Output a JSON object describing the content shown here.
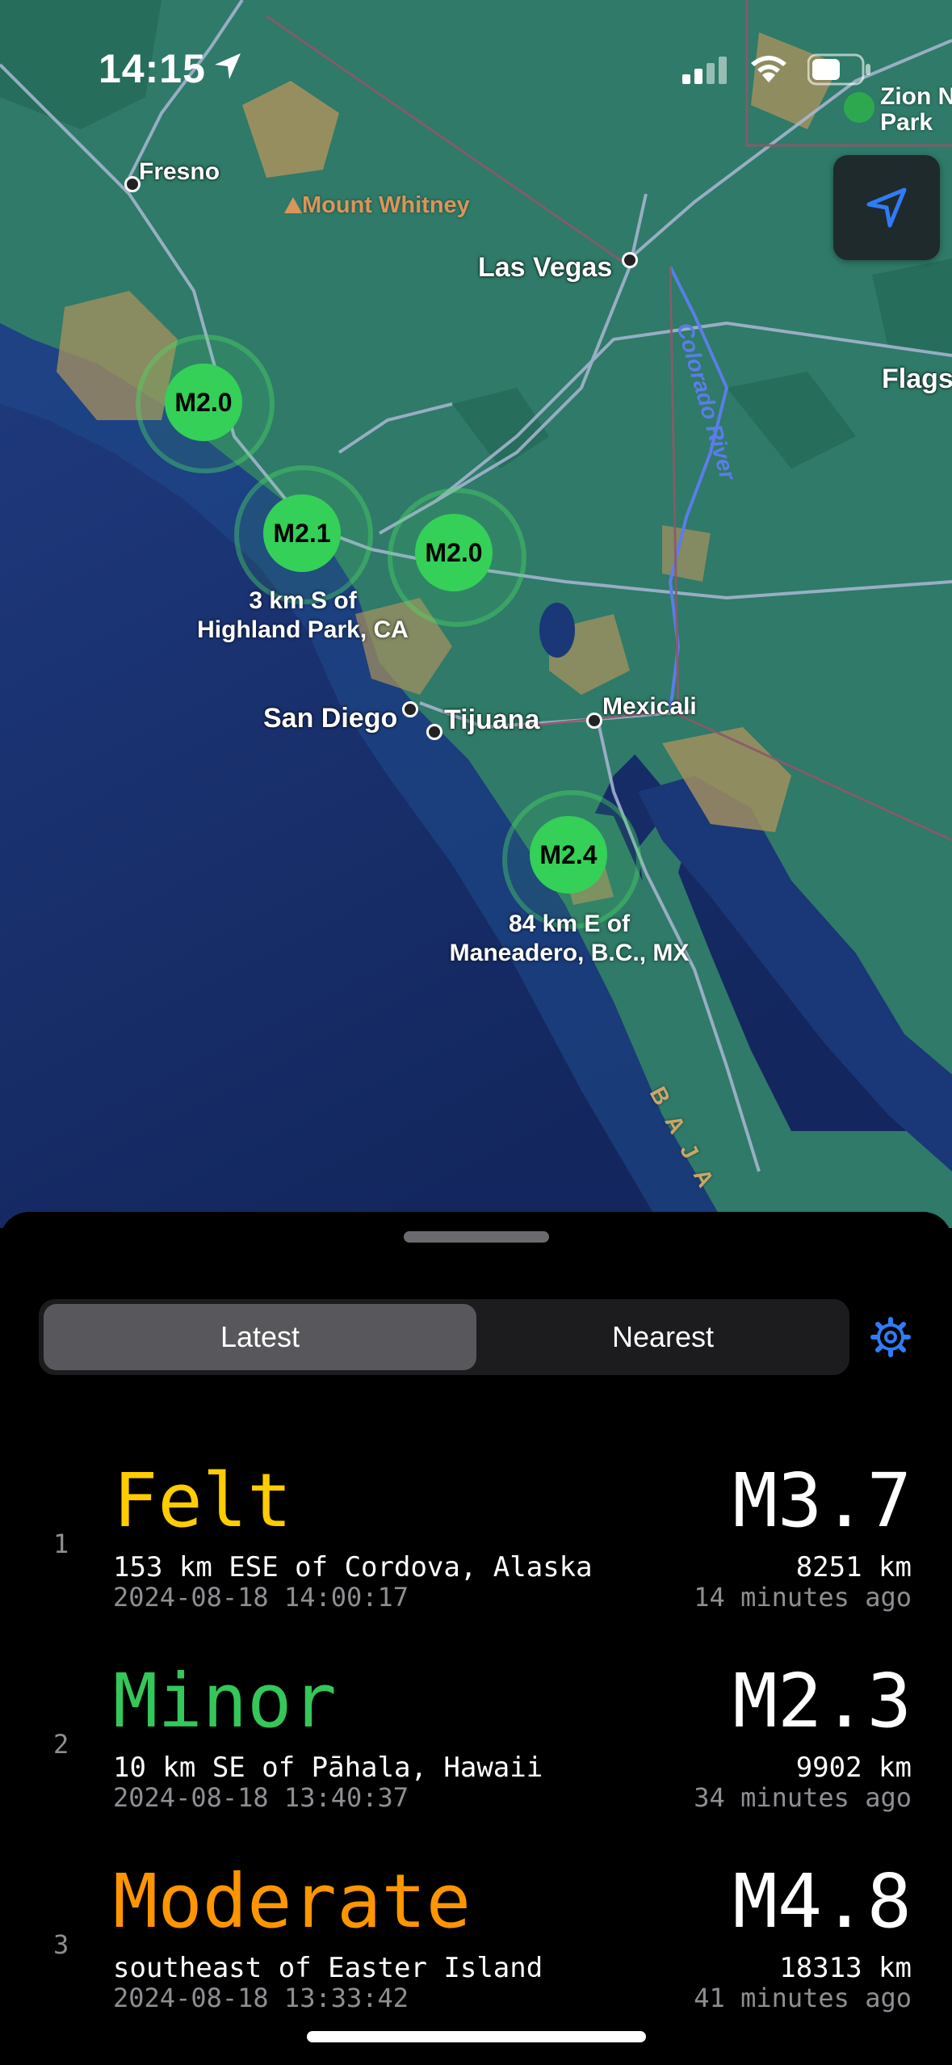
{
  "status_bar": {
    "time": "14:15"
  },
  "map": {
    "labels": {
      "fresno": "Fresno",
      "mount_whitney": "Mount Whitney",
      "las_vegas": "Las Vegas",
      "zion": "Zion N\nPark",
      "flagstaff": "Flags",
      "colorado_river": "Colorado River",
      "san_diego": "San Diego",
      "tijuana": "Tijuana",
      "mexicali": "Mexicali",
      "baja": "B A J A"
    },
    "quakes": [
      {
        "magnitude": "M2.0",
        "caption": ""
      },
      {
        "magnitude": "M2.1",
        "caption": "3 km S of\nHighland Park, CA"
      },
      {
        "magnitude": "M2.0",
        "caption": ""
      },
      {
        "magnitude": "M2.4",
        "caption": "84 km E of\nManeadero, B.C., MX"
      }
    ]
  },
  "sheet": {
    "tabs": {
      "latest": "Latest",
      "nearest": "Nearest",
      "selected": "Latest"
    },
    "list": [
      {
        "index": "1",
        "category": "Felt",
        "category_color": "#ffcc00",
        "place": "153 km ESE of Cordova, Alaska",
        "time": "2024-08-18 14:00:17",
        "magnitude": "M3.7",
        "distance": "8251 km",
        "ago": "14 minutes ago"
      },
      {
        "index": "2",
        "category": "Minor",
        "category_color": "#34c759",
        "place": "10 km SE of Pāhala, Hawaii",
        "time": "2024-08-18 13:40:37",
        "magnitude": "M2.3",
        "distance": "9902 km",
        "ago": "34 minutes ago"
      },
      {
        "index": "3",
        "category": "Moderate",
        "category_color": "#ff9500",
        "place": "southeast of Easter Island",
        "time": "2024-08-18 13:33:42",
        "magnitude": "M4.8",
        "distance": "18313 km",
        "ago": "41 minutes ago"
      }
    ]
  },
  "colors": {
    "accent": "#2f7cf6",
    "quake_green": "#34d058",
    "ocean": "#1c3d7a",
    "land": "#2f7a68"
  }
}
